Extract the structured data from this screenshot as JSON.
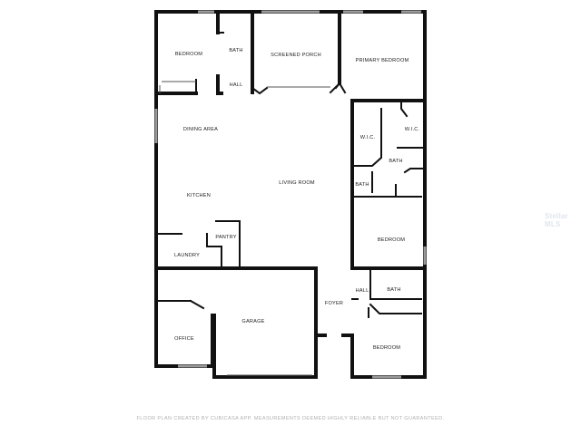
{
  "rooms": {
    "bedroom_nw": "BEDROOM",
    "bath_n": "BATH",
    "screened_porch": "SCREENED PORCH",
    "primary_bedroom": "PRIMARY BEDROOM",
    "hall_n": "HALL",
    "dining_area": "DINING AREA",
    "wic_left": "W.I.C.",
    "wic_right": "W.I.C.",
    "bath_primary": "BATH",
    "living_room": "LIVING ROOM",
    "bath_small": "BATH",
    "kitchen": "KITCHEN",
    "pantry": "PANTRY",
    "bedroom_e": "BEDROOM",
    "laundry": "LAUNDRY",
    "hall_e": "HALL",
    "bath_e": "BATH",
    "foyer": "FOYER",
    "garage": "GARAGE",
    "office": "OFFICE",
    "bedroom_se": "BEDROOM"
  },
  "footer": "FLOOR PLAN CREATED BY CUBICASA APP. MEASUREMENTS DEEMED HIGHLY RELIABLE BUT NOT GUARANTEED.",
  "watermark": "Stellar MLS",
  "colors": {
    "wall": "#111111",
    "window": "#9a9a9a",
    "footer": "#b0b0b0"
  }
}
